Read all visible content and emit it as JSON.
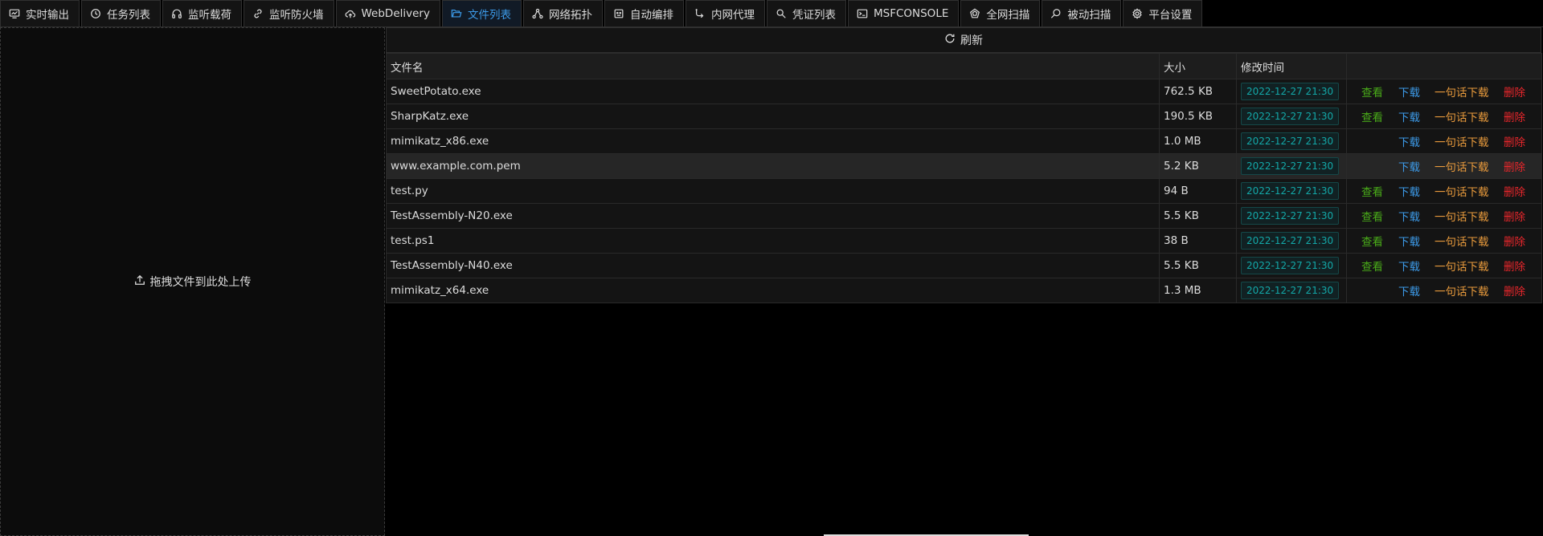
{
  "tabs": [
    {
      "label": "实时输出",
      "icon": "monitor-icon",
      "active": false
    },
    {
      "label": "任务列表",
      "icon": "clock-icon",
      "active": false
    },
    {
      "label": "监听载荷",
      "icon": "headphones-icon",
      "active": false
    },
    {
      "label": "监听防火墙",
      "icon": "link-icon",
      "active": false
    },
    {
      "label": "WebDelivery",
      "icon": "cloud-upload-icon",
      "active": false
    },
    {
      "label": "文件列表",
      "icon": "folder-icon",
      "active": true
    },
    {
      "label": "网络拓扑",
      "icon": "network-icon",
      "active": false
    },
    {
      "label": "自动编排",
      "icon": "robot-icon",
      "active": false
    },
    {
      "label": "内网代理",
      "icon": "proxy-icon",
      "active": false
    },
    {
      "label": "凭证列表",
      "icon": "key-icon",
      "active": false
    },
    {
      "label": "MSFCONSOLE",
      "icon": "terminal-icon",
      "active": false
    },
    {
      "label": "全网扫描",
      "icon": "radar-icon",
      "active": false
    },
    {
      "label": "被动扫描",
      "icon": "search-icon",
      "active": false
    },
    {
      "label": "平台设置",
      "icon": "gear-icon",
      "active": false
    }
  ],
  "upload": {
    "hint": "拖拽文件到此处上传"
  },
  "refresh": {
    "label": "刷新"
  },
  "table": {
    "columns": {
      "name": "文件名",
      "size": "大小",
      "mtime": "修改时间",
      "actions": ""
    },
    "action_labels": {
      "view": "查看",
      "download": "下载",
      "oneliner": "一句话下载",
      "delete": "删除"
    },
    "rows": [
      {
        "name": "SweetPotato.exe",
        "size": "762.5 KB",
        "mtime": "2022-12-27 21:30",
        "viewable": true
      },
      {
        "name": "SharpKatz.exe",
        "size": "190.5 KB",
        "mtime": "2022-12-27 21:30",
        "viewable": true
      },
      {
        "name": "mimikatz_x86.exe",
        "size": "1.0 MB",
        "mtime": "2022-12-27 21:30",
        "viewable": false
      },
      {
        "name": "www.example.com.pem",
        "size": "5.2 KB",
        "mtime": "2022-12-27 21:30",
        "viewable": false
      },
      {
        "name": "test.py",
        "size": "94 B",
        "mtime": "2022-12-27 21:30",
        "viewable": true
      },
      {
        "name": "TestAssembly-N20.exe",
        "size": "5.5 KB",
        "mtime": "2022-12-27 21:30",
        "viewable": true
      },
      {
        "name": "test.ps1",
        "size": "38 B",
        "mtime": "2022-12-27 21:30",
        "viewable": true
      },
      {
        "name": "TestAssembly-N40.exe",
        "size": "5.5 KB",
        "mtime": "2022-12-27 21:30",
        "viewable": true
      },
      {
        "name": "mimikatz_x64.exe",
        "size": "1.3 MB",
        "mtime": "2022-12-27 21:30",
        "viewable": false
      }
    ],
    "hover_row": 3
  },
  "colors": {
    "accent": "#3c9ae8",
    "view": "#49aa19",
    "oneliner": "#e89a3c",
    "delete": "#e8262b",
    "date_tag": "#13a8a8"
  }
}
